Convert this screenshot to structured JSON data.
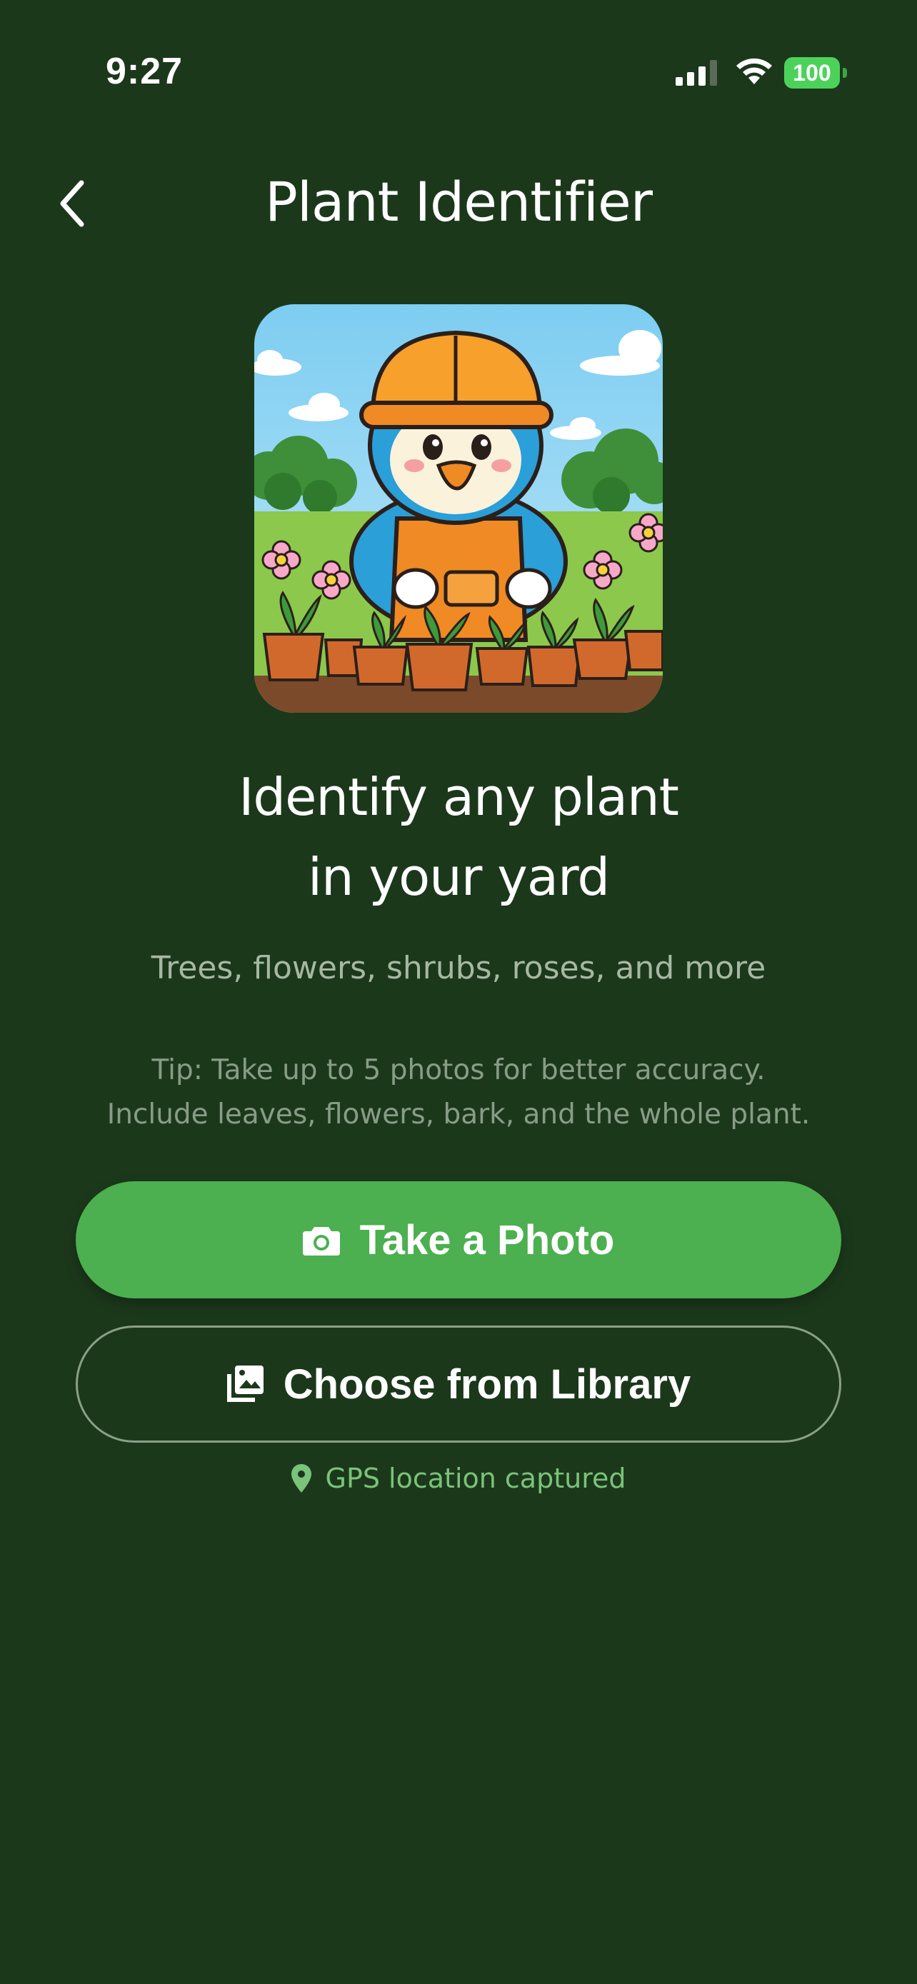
{
  "status_bar": {
    "time": "9:27",
    "battery": "100",
    "icons": [
      "signal-icon",
      "wifi-icon",
      "battery-icon"
    ]
  },
  "nav": {
    "back_icon": "chevron-left-icon",
    "title": "Plant Identifier"
  },
  "hero": {
    "illustration": "bird-gardener-illustration"
  },
  "headline": {
    "line1": "Identify any plant",
    "line2": "in your yard"
  },
  "subtitle": "Trees, flowers, shrubs, roses, and more",
  "tip": {
    "line1": "Tip: Take up to 5 photos for better accuracy.",
    "line2": "Include leaves, flowers, bark, and the whole plant."
  },
  "actions": {
    "take_photo": {
      "label": "Take a Photo",
      "icon": "camera-icon"
    },
    "choose_library": {
      "label": "Choose from Library",
      "icon": "photo-library-icon"
    }
  },
  "gps": {
    "icon": "location-pin-icon",
    "text": "GPS location captured"
  },
  "colors": {
    "background": "#1c381b",
    "primary_button": "#4caf50",
    "accent_text": "#79c37a",
    "battery": "#4cd25a"
  }
}
